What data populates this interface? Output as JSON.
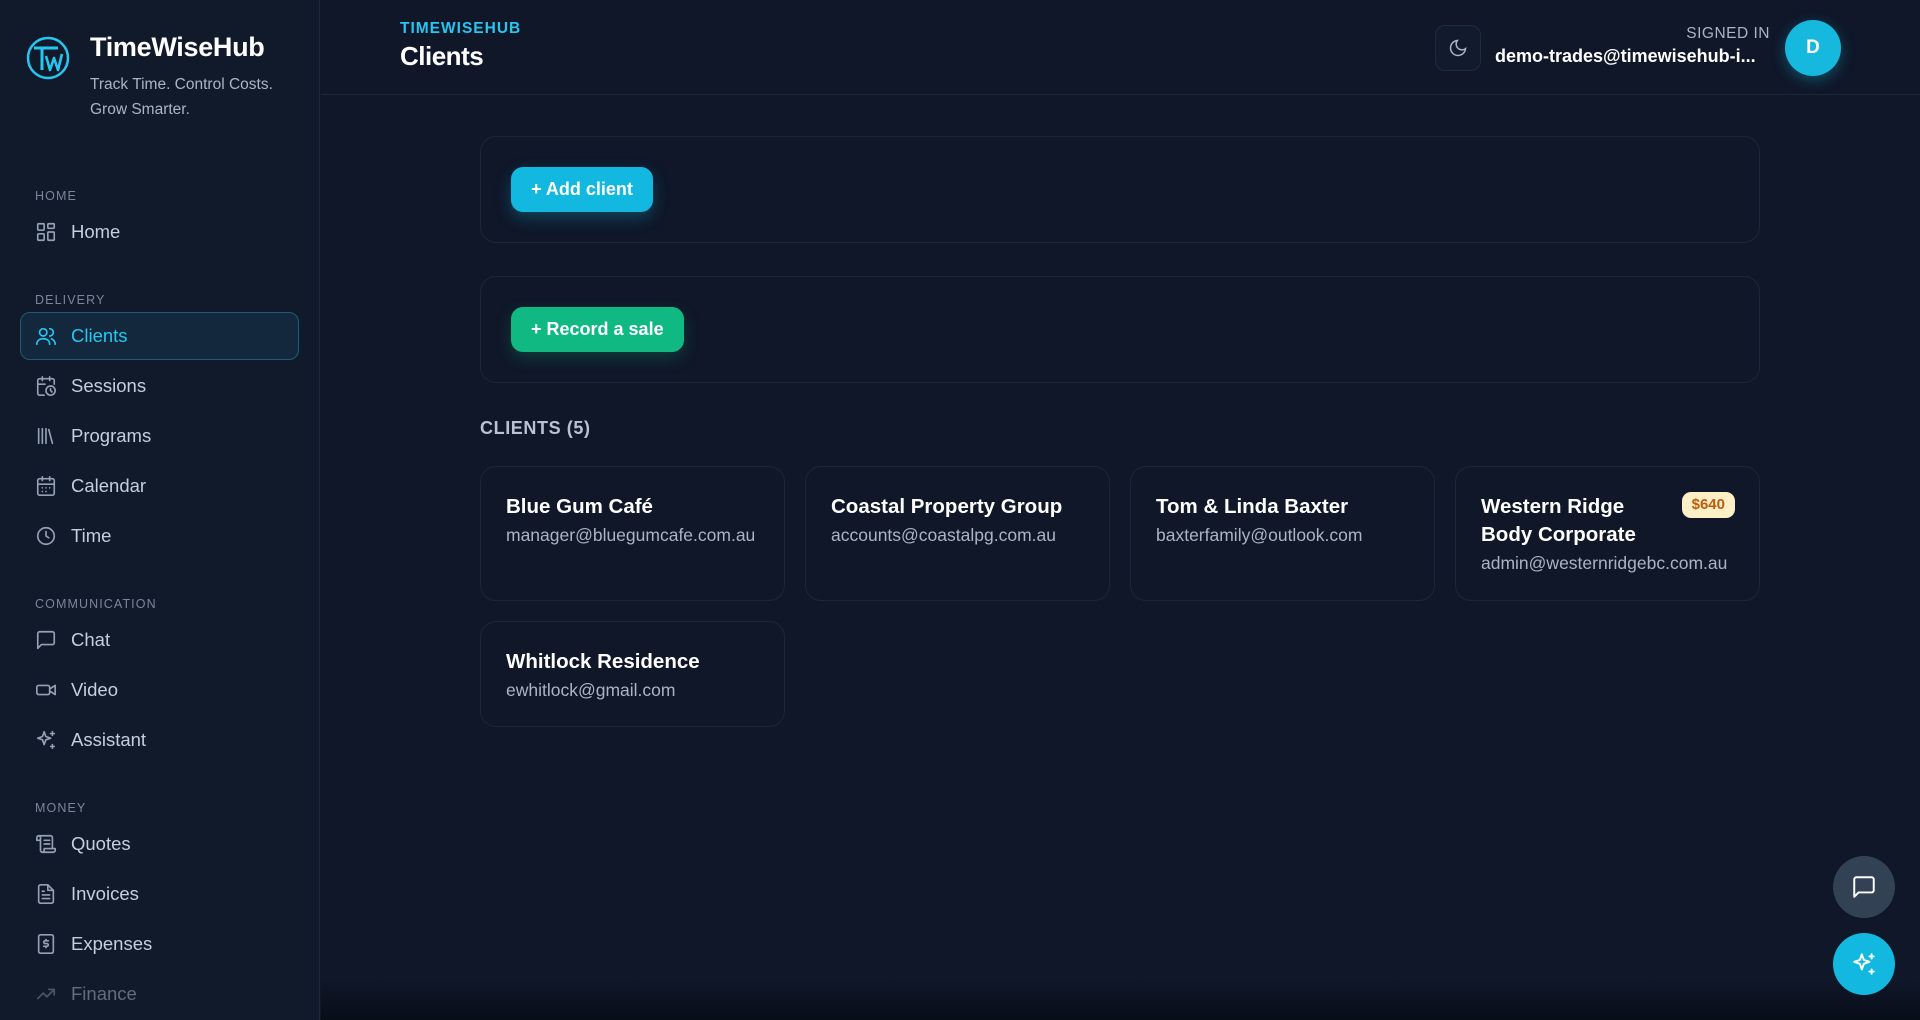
{
  "brand": {
    "name": "TimeWiseHub",
    "tagline": "Track Time. Control Costs. Grow Smarter.",
    "logo_icon": "tw-logo-icon"
  },
  "sidebar": {
    "sections": [
      {
        "label": "HOME",
        "items": [
          {
            "label": "Home",
            "icon": "grid-icon"
          }
        ]
      },
      {
        "label": "DELIVERY",
        "items": [
          {
            "label": "Clients",
            "icon": "users-icon",
            "active": true
          },
          {
            "label": "Sessions",
            "icon": "calendar-clock-icon"
          },
          {
            "label": "Programs",
            "icon": "library-icon"
          },
          {
            "label": "Calendar",
            "icon": "calendar-icon"
          },
          {
            "label": "Time",
            "icon": "clock-icon"
          }
        ]
      },
      {
        "label": "COMMUNICATION",
        "items": [
          {
            "label": "Chat",
            "icon": "message-icon"
          },
          {
            "label": "Video",
            "icon": "video-icon"
          },
          {
            "label": "Assistant",
            "icon": "sparkles-icon"
          }
        ]
      },
      {
        "label": "MONEY",
        "items": [
          {
            "label": "Quotes",
            "icon": "scroll-icon"
          },
          {
            "label": "Invoices",
            "icon": "file-icon"
          },
          {
            "label": "Expenses",
            "icon": "receipt-icon"
          },
          {
            "label": "Finance",
            "icon": "trending-up-icon"
          }
        ]
      }
    ]
  },
  "header": {
    "eyebrow": "TIMEWISEHUB",
    "title": "Clients",
    "signed_in_label": "SIGNED IN",
    "user_email": "demo-trades@timewisehub-i...",
    "avatar_initial": "D",
    "theme_toggle_icon": "moon-icon"
  },
  "actions": {
    "add_client": "+ Add client",
    "record_sale": "+ Record a sale"
  },
  "clients": {
    "heading": "CLIENTS (5)",
    "items": [
      {
        "name": "Blue Gum Café",
        "email": "manager@bluegumcafe.com.au",
        "badge": ""
      },
      {
        "name": "Coastal Property Group",
        "email": "accounts@coastalpg.com.au",
        "badge": ""
      },
      {
        "name": "Tom & Linda Baxter",
        "email": "baxterfamily@outlook.com",
        "badge": ""
      },
      {
        "name": "Western Ridge Body Corporate",
        "email": "admin@westernridgebc.com.au",
        "badge": "$640"
      },
      {
        "name": "Whitlock Residence",
        "email": "ewhitlock@gmail.com",
        "badge": ""
      }
    ]
  },
  "fabs": {
    "chat_icon": "message-icon",
    "assistant_icon": "sparkles-icon"
  },
  "colors": {
    "accent": "#12b8df",
    "success": "#10b981",
    "background": "#0f1729",
    "badge_bg": "#fdf0c7",
    "badge_text": "#c05a0e"
  }
}
